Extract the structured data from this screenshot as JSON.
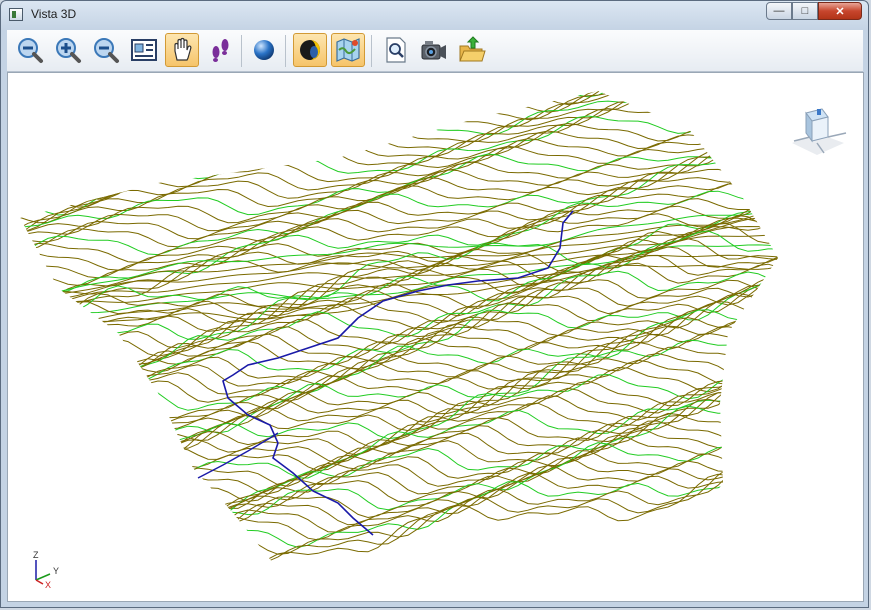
{
  "window": {
    "title": "Vista 3D"
  },
  "title_controls": {
    "minimize": "—",
    "maximize": "□",
    "close": "✕"
  },
  "toolbar": {
    "buttons": [
      {
        "name": "zoom-fit-icon",
        "active": false
      },
      {
        "name": "zoom-in-icon",
        "active": false
      },
      {
        "name": "zoom-out-icon",
        "active": false
      },
      {
        "name": "zoom-window-icon",
        "active": false
      },
      {
        "name": "pan-hand-icon",
        "active": true
      },
      {
        "name": "walk-footprints-icon",
        "active": false
      },
      {
        "name": "sphere-icon",
        "active": false
      },
      {
        "name": "shading-icon",
        "active": true
      },
      {
        "name": "map-icon",
        "active": true
      },
      {
        "name": "preview-magnifier-icon",
        "active": false
      },
      {
        "name": "camera-icon",
        "active": false
      },
      {
        "name": "export-folder-icon",
        "active": false
      }
    ]
  },
  "axes": {
    "z": "Z",
    "y": "Y",
    "x": "X"
  },
  "colors": {
    "contour_major": "#7a6a00",
    "contour_minor": "#22cc22",
    "stream": "#1a1aa8",
    "accent": "#f6c46a"
  }
}
